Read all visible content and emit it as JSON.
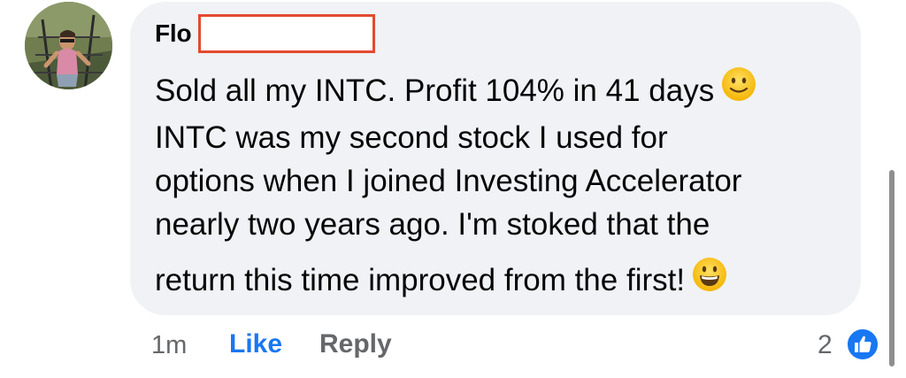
{
  "comment": {
    "author": "Flo",
    "lines": [
      "Sold all my INTC. Profit 104% in 41 days",
      "INTC was my second stock I used for",
      "options when I joined Investing Accelerator",
      "nearly two years ago. I'm stoked that the",
      "return this time improved from the first!"
    ],
    "emojis": [
      "slightly-smiling-face-icon",
      "grinning-face-icon"
    ]
  },
  "meta": {
    "timestamp": "1m",
    "like_label": "Like",
    "reply_label": "Reply",
    "reaction_count": "2",
    "reaction_icon": "thumbs-up-icon"
  },
  "colors": {
    "bubble": "#f0f2f5",
    "like_blue": "#1877f2",
    "secondary_text": "#65676b",
    "redaction_border": "#e44a2f"
  }
}
